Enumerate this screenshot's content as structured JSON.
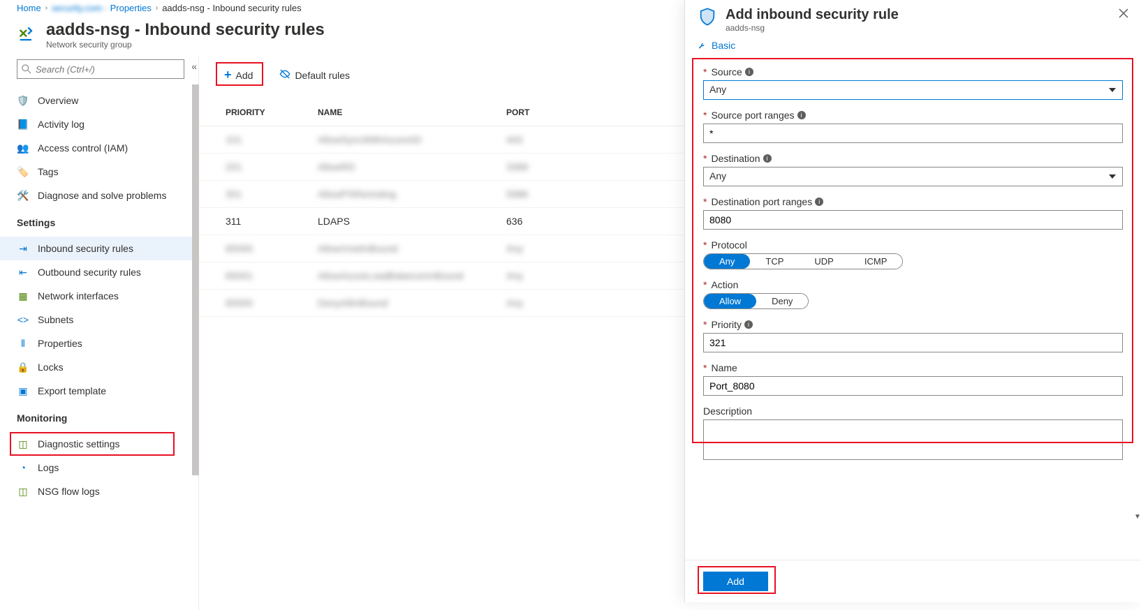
{
  "breadcrumb": {
    "home": "Home",
    "prop": "Properties",
    "prop_blur": "security.com - ",
    "current": "aadds-nsg - Inbound security rules"
  },
  "header": {
    "title": "aadds-nsg - Inbound security rules",
    "subtitle": "Network security group"
  },
  "sidebar": {
    "search_placeholder": "Search (Ctrl+/)",
    "items_top": [
      {
        "label": "Overview"
      },
      {
        "label": "Activity log"
      },
      {
        "label": "Access control (IAM)"
      },
      {
        "label": "Tags"
      },
      {
        "label": "Diagnose and solve problems"
      }
    ],
    "heading_settings": "Settings",
    "items_settings": [
      {
        "label": "Inbound security rules"
      },
      {
        "label": "Outbound security rules"
      },
      {
        "label": "Network interfaces"
      },
      {
        "label": "Subnets"
      },
      {
        "label": "Properties"
      },
      {
        "label": "Locks"
      },
      {
        "label": "Export template"
      }
    ],
    "heading_monitoring": "Monitoring",
    "items_monitoring": [
      {
        "label": "Diagnostic settings"
      },
      {
        "label": "Logs"
      },
      {
        "label": "NSG flow logs"
      }
    ]
  },
  "toolbar": {
    "add": "Add",
    "default_rules": "Default rules"
  },
  "table": {
    "col_priority": "PRIORITY",
    "col_name": "NAME",
    "col_port": "PORT",
    "rows": [
      {
        "priority": "101",
        "name": "AllowSyncWithAzureAD",
        "port": "443",
        "blur": true
      },
      {
        "priority": "201",
        "name": "AllowRD",
        "port": "3389",
        "blur": true
      },
      {
        "priority": "301",
        "name": "AllowPSRemoting",
        "port": "5986",
        "blur": true
      },
      {
        "priority": "311",
        "name": "LDAPS",
        "port": "636",
        "blur": false
      },
      {
        "priority": "65000",
        "name": "AllowVnetInBound",
        "port": "Any",
        "blur": true
      },
      {
        "priority": "65001",
        "name": "AllowAzureLoadBalancerInBound",
        "port": "Any",
        "blur": true
      },
      {
        "priority": "65500",
        "name": "DenyAllInBound",
        "port": "Any",
        "blur": true
      }
    ]
  },
  "panel": {
    "title": "Add inbound security rule",
    "subtitle": "aadds-nsg",
    "basic_link": "Basic",
    "labels": {
      "source": "Source",
      "source_port": "Source port ranges",
      "destination": "Destination",
      "dest_port": "Destination port ranges",
      "protocol": "Protocol",
      "action": "Action",
      "priority": "Priority",
      "name": "Name",
      "description": "Description"
    },
    "values": {
      "source": "Any",
      "source_port": "*",
      "destination": "Any",
      "dest_port": "8080",
      "priority": "321",
      "name": "Port_8080"
    },
    "protocol_options": [
      "Any",
      "TCP",
      "UDP",
      "ICMP"
    ],
    "protocol_selected": "Any",
    "action_options": [
      "Allow",
      "Deny"
    ],
    "action_selected": "Allow",
    "add_button": "Add"
  }
}
